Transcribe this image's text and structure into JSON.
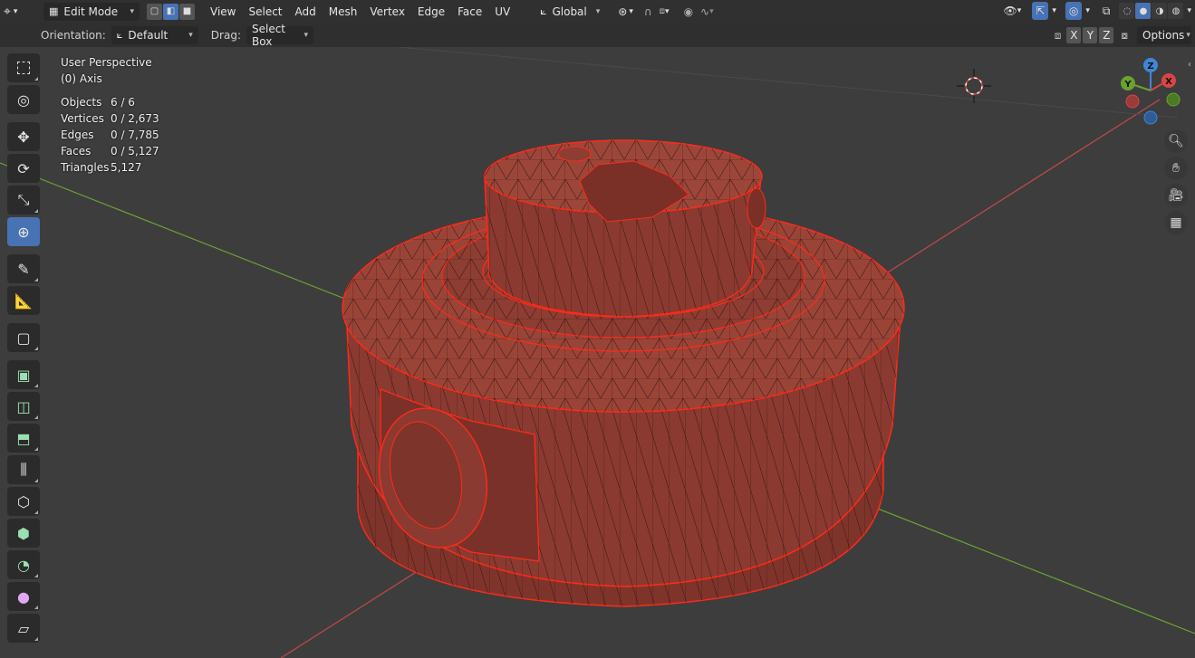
{
  "header": {
    "editor_type_icon": "3d-viewport-icon",
    "mode": "Edit Mode",
    "select_modes": [
      "vertex-select-icon",
      "edge-select-icon",
      "face-select-icon"
    ],
    "active_select_mode": 1,
    "menus": [
      "View",
      "Select",
      "Add",
      "Mesh",
      "Vertex",
      "Edge",
      "Face",
      "UV"
    ],
    "transform_orientation": "Global"
  },
  "tool_settings": {
    "orientation_label": "Orientation:",
    "orientation_value": "Default",
    "drag_label": "Drag:",
    "drag_value": "Select Box",
    "axes": [
      "X",
      "Y",
      "Z"
    ],
    "options_label": "Options"
  },
  "overlay": {
    "perspective": "User Perspective",
    "object_name": "(0) Axis",
    "stats": [
      {
        "label": "Objects",
        "value": "6 / 6"
      },
      {
        "label": "Vertices",
        "value": "0 / 2,673"
      },
      {
        "label": "Edges",
        "value": "0 / 7,785"
      },
      {
        "label": "Faces",
        "value": "0 / 5,127"
      },
      {
        "label": "Triangles",
        "value": "5,127"
      }
    ]
  },
  "gizmo": {
    "x": "X",
    "y": "Y",
    "z": "Z"
  },
  "colors": {
    "accent": "#4772b3",
    "mesh": "#8a3a30",
    "wire": "#ff2a1a",
    "x_axis": "#d94545",
    "y_axis": "#6aa32e",
    "z_axis": "#3f86d9"
  },
  "tools": [
    "select-box-icon",
    "cursor-icon",
    "move-icon",
    "rotate-icon",
    "scale-icon",
    "transform-icon",
    "annotate-icon",
    "measure-icon",
    "add-cube-icon",
    "extrude-icon",
    "inset-icon",
    "bevel-icon",
    "loop-cut-icon",
    "knife-icon",
    "poly-build-icon",
    "spin-icon",
    "smooth-icon",
    "shear-icon"
  ]
}
